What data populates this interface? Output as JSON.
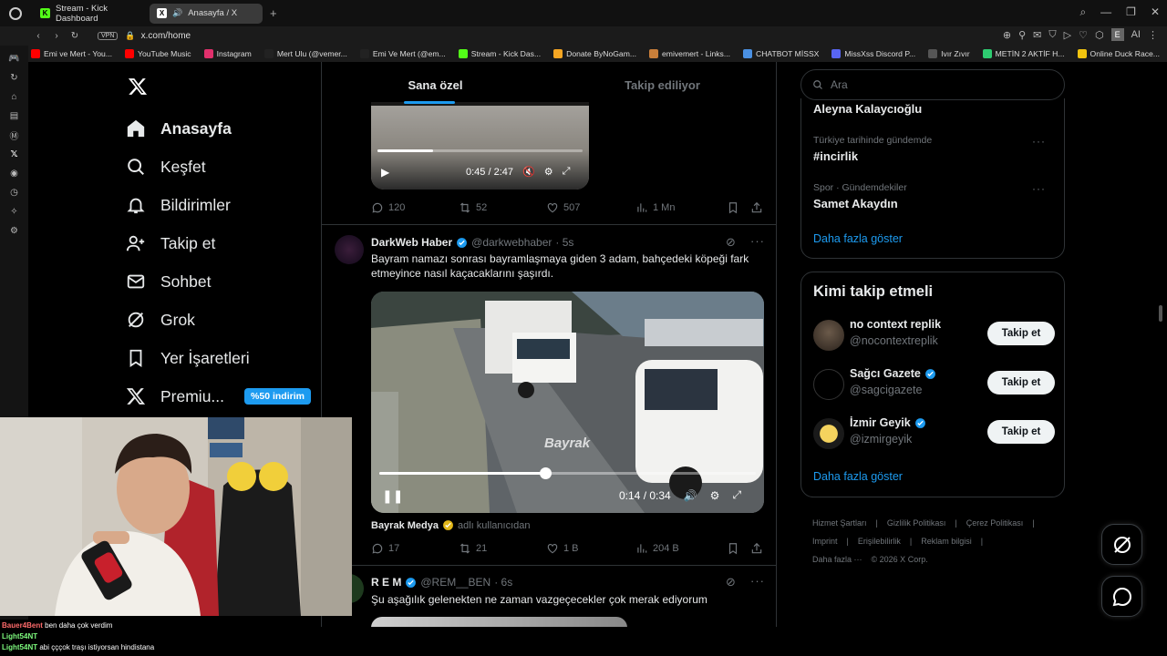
{
  "browser": {
    "tabs": [
      {
        "label": "Stream - Kick Dashboard",
        "favicon": "K"
      },
      {
        "label": "Anasayfa / X",
        "favicon": "X"
      }
    ],
    "vpn_label": "VPN",
    "url": "x.com/home",
    "profile_letter": "E",
    "ai_label": "AI",
    "bookmarks": [
      {
        "label": "Emi ve Mert - You...",
        "color": "#ff0000"
      },
      {
        "label": "YouTube Music",
        "color": "#ff0000"
      },
      {
        "label": "Instagram",
        "color": "#e1306c"
      },
      {
        "label": "Mert Ulu (@vemer...",
        "color": "#222222"
      },
      {
        "label": "Emi Ve Mert (@em...",
        "color": "#222222"
      },
      {
        "label": "Stream - Kick Das...",
        "color": "#53fc18"
      },
      {
        "label": "Donate ByNoGam...",
        "color": "#f5a623"
      },
      {
        "label": "emivemert - Links...",
        "color": "#c97f3a"
      },
      {
        "label": "CHATBOT MİSSX",
        "color": "#4a90e2"
      },
      {
        "label": "MissXss Discord P...",
        "color": "#5865f2"
      },
      {
        "label": "Ivır Zıvır",
        "color": "#555555"
      },
      {
        "label": "METİN 2 AKTİF H...",
        "color": "#2ecc71"
      },
      {
        "label": "Online Duck Race...",
        "color": "#f1c40f"
      }
    ]
  },
  "x_nav": {
    "items": [
      {
        "label": "Anasayfa",
        "icon": "home-icon"
      },
      {
        "label": "Keşfet",
        "icon": "search-icon"
      },
      {
        "label": "Bildirimler",
        "icon": "bell-icon"
      },
      {
        "label": "Takip et",
        "icon": "follow-icon"
      },
      {
        "label": "Sohbet",
        "icon": "mail-icon"
      },
      {
        "label": "Grok",
        "icon": "grok-icon"
      },
      {
        "label": "Yer İşaretleri",
        "icon": "bookmark-icon"
      },
      {
        "label": "Premiu...",
        "icon": "x-premium-icon"
      }
    ],
    "premium_badge": "%50 indirim"
  },
  "timeline": {
    "tabs": [
      "Sana özel",
      "Takip ediliyor"
    ],
    "posts": [
      {
        "video_time": "0:45 / 2:47",
        "video_progress": 0.27,
        "replies": "120",
        "reposts": "52",
        "likes": "507",
        "views": "1 Mn"
      },
      {
        "name": "DarkWeb Haber",
        "handle": "@darkwebhaber",
        "time": "· 5s",
        "text": "Bayram namazı sonrası bayramlaşmaya giden 3 adam, bahçedeki köpeği fark etmeyince nasıl kaçacaklarını şaşırdı.",
        "video_watermark": "Bayrak",
        "video_time": "0:14 / 0:34",
        "video_progress": 0.44,
        "credit_name": "Bayrak Medya",
        "credit_suffix": "adlı kullanıcıdan",
        "replies": "17",
        "reposts": "21",
        "likes": "1 B",
        "views": "204 B"
      },
      {
        "name": "R E M",
        "handle": "@REM__BEN",
        "time": "· 6s",
        "text": "Şu aşağılık gelenekten ne zaman vazgeçecekler çok merak ediyorum"
      }
    ]
  },
  "right": {
    "search_placeholder": "Ara",
    "trends": [
      {
        "category": "",
        "name": "Aleyna Kalaycıoğlu"
      },
      {
        "category": "Türkiye tarihinde gündemde",
        "name": "#incirlik"
      },
      {
        "category": "Spor · Gündemdekiler",
        "name": "Samet Akaydın"
      }
    ],
    "trends_show_more": "Daha fazla göster",
    "who_to_follow_title": "Kimi takip etmeli",
    "who_to_follow": [
      {
        "name": "no context replik",
        "handle": "@nocontextreplik",
        "verified": false,
        "button": "Takip et"
      },
      {
        "name": "Sağcı Gazete",
        "handle": "@sagcigazete",
        "verified": true,
        "button": "Takip et"
      },
      {
        "name": "İzmir Geyik",
        "handle": "@izmirgeyik",
        "verified": true,
        "button": "Takip et"
      }
    ],
    "follow_show_more": "Daha fazla göster",
    "footer": [
      "Hizmet Şartları",
      "|",
      "Gizlilik Politikası",
      "|",
      "Çerez Politikası",
      "|",
      "Imprint",
      "|",
      "Erişilebilirlik",
      "|",
      "Reklam bilgisi",
      "|",
      "Daha fazla ···",
      "© 2026 X Corp."
    ]
  },
  "stream_chat": [
    {
      "user": "Bauer4Bent",
      "text": "ben daha çok verdim"
    },
    {
      "user": "Light54NT",
      "text": ""
    },
    {
      "user": "Light54NT",
      "text": "abi çççok traşı istiyorsan hindistana"
    }
  ],
  "colors": {
    "accent": "#1d9bf0",
    "bg": "#000000",
    "border": "#2f3336",
    "muted": "#71767b"
  }
}
